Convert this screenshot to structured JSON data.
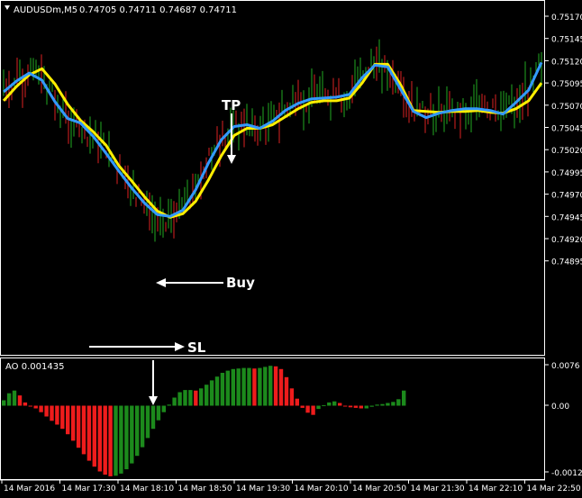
{
  "header": {
    "symbol": "AUDUSDm,M5",
    "ohlc": "0.74705 0.74711 0.74687 0.74711"
  },
  "indicator": {
    "label": "AO 0.001435"
  },
  "annotations": {
    "tp": "TP",
    "buy": "Buy",
    "sl": "SL"
  },
  "colors": {
    "background": "#000000",
    "axis": "#ffffff",
    "bull_bar": "#22aa22",
    "bear_bar": "#dd2222",
    "ma_fast": "#3399ff",
    "ma_slow": "#ffee00",
    "ao_up": "#1c8a1c",
    "ao_down": "#ee1c1c"
  },
  "chart_data": [
    {
      "type": "line",
      "y_ticks": [
        "0.75170",
        "0.75145",
        "0.75120",
        "0.75095",
        "0.75070",
        "0.75045",
        "0.75020",
        "0.74995",
        "0.74970",
        "0.74945",
        "0.74920",
        "0.74895"
      ],
      "x_ticks": [
        "14 Mar 2016",
        "14 Mar 17:30",
        "14 Mar 18:10",
        "14 Mar 18:50",
        "14 Mar 19:30",
        "14 Mar 20:10",
        "14 Mar 20:50",
        "14 Mar 21:30",
        "14 Mar 22:10",
        "14 Mar 22:50"
      ],
      "ylim": [
        0.74885,
        0.75182
      ],
      "series": [
        {
          "role": "fast-ma",
          "values": [
            0.75085,
            0.75097,
            0.75106,
            0.75098,
            0.75074,
            0.75055,
            0.7505,
            0.75035,
            0.75016,
            0.74996,
            0.74977,
            0.7496,
            0.74947,
            0.74945,
            0.74952,
            0.74975,
            0.75005,
            0.75031,
            0.75046,
            0.75048,
            0.75044,
            0.75052,
            0.75064,
            0.75072,
            0.75077,
            0.75078,
            0.75079,
            0.75082,
            0.75101,
            0.75115,
            0.75113,
            0.75088,
            0.75063,
            0.75056,
            0.75061,
            0.75064,
            0.75066,
            0.75066,
            0.75064,
            0.7506,
            0.75073,
            0.75087,
            0.75118
          ]
        },
        {
          "role": "slow-ma",
          "values": [
            0.75075,
            0.75091,
            0.75104,
            0.75111,
            0.75094,
            0.75071,
            0.75053,
            0.7504,
            0.75025,
            0.75002,
            0.74985,
            0.74967,
            0.74951,
            0.74944,
            0.74948,
            0.74962,
            0.74986,
            0.75013,
            0.75036,
            0.75044,
            0.75044,
            0.75048,
            0.75057,
            0.75066,
            0.75073,
            0.75075,
            0.75075,
            0.75078,
            0.75095,
            0.75116,
            0.75116,
            0.75093,
            0.75064,
            0.75063,
            0.75062,
            0.75063,
            0.75063,
            0.75064,
            0.75062,
            0.75061,
            0.75066,
            0.75075,
            0.75095
          ]
        }
      ]
    },
    {
      "type": "bar",
      "ylim": [
        -0.00138,
        0.00082
      ],
      "y_ticks": [
        "0.0076",
        "0.00",
        "-0.0012"
      ],
      "values": [
        0.0001,
        0.00023,
        0.00028,
        0.00019,
        6e-05,
        0.0,
        -5e-05,
        -0.00012,
        -0.0002,
        -0.00028,
        -0.00035,
        -0.00043,
        -0.00053,
        -0.00065,
        -0.00078,
        -0.0009,
        -0.00102,
        -0.00113,
        -0.00122,
        -0.00128,
        -0.00131,
        -0.0013,
        -0.00126,
        -0.00118,
        -0.00107,
        -0.00093,
        -0.00077,
        -0.0006,
        -0.00043,
        -0.00027,
        -0.00012,
        2e-05,
        0.00015,
        0.00025,
        0.00029,
        0.00029,
        0.00028,
        0.00032,
        0.00039,
        0.00047,
        0.00054,
        0.00061,
        0.00065,
        0.00068,
        0.00069,
        0.0007,
        0.0007,
        0.00069,
        0.0007,
        0.00072,
        0.00074,
        0.00073,
        0.00068,
        0.00053,
        0.00032,
        0.00013,
        -4e-05,
        -0.00013,
        -0.00017,
        -6e-05,
        1e-05,
        6e-05,
        8e-05,
        5e-05,
        -1e-05,
        -3e-05,
        -4e-05,
        -5e-05,
        -5e-05,
        -2e-05,
        2e-05,
        3e-05,
        5e-05,
        7e-05,
        0.00012,
        0.00028
      ]
    }
  ]
}
